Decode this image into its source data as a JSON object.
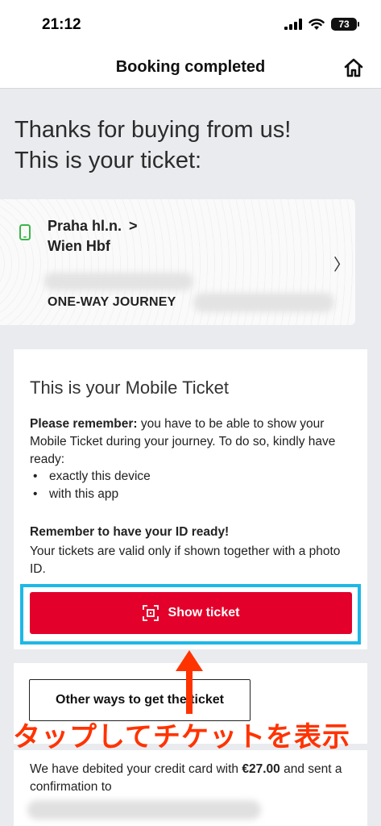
{
  "status_bar": {
    "time": "21:12",
    "battery": "73",
    "icons": [
      "signal-icon",
      "wifi-icon",
      "battery-icon"
    ]
  },
  "nav": {
    "title": "Booking completed",
    "home_icon": "home-icon"
  },
  "heading": {
    "line1": "Thanks for buying from us!",
    "line2": "This is your ticket:"
  },
  "ticket": {
    "from": "Praha hl.n.",
    "to": "Wien Hbf",
    "from_arrow": ">",
    "journey_type": "ONE-WAY JOURNEY",
    "open_arrow": "〉"
  },
  "mobile_ticket": {
    "title": "This is your Mobile Ticket",
    "remember_bold": "Please remember:",
    "remember_text": " you have to be able to show your Mobile Ticket during your journey. To do so, kindly have ready:",
    "bullets": [
      "exactly this device",
      "with this app"
    ],
    "id_title": "Remember to have your ID ready!",
    "id_text": "Your tickets are valid only if shown together with a photo ID.",
    "show_ticket_label": "Show ticket"
  },
  "other_ways": {
    "label": "Other ways to get the ticket"
  },
  "annotation": {
    "text": "タップしてチケットを表示"
  },
  "debit": {
    "text_before": "We have debited your credit card with ",
    "amount": "€27.00",
    "text_after": " and sent a confirmation to"
  },
  "colors": {
    "accent_red": "#e3002a",
    "highlight_cyan": "#1eb8e6",
    "annotation_orange": "#ff3300",
    "device_green": "#3bb54a"
  }
}
